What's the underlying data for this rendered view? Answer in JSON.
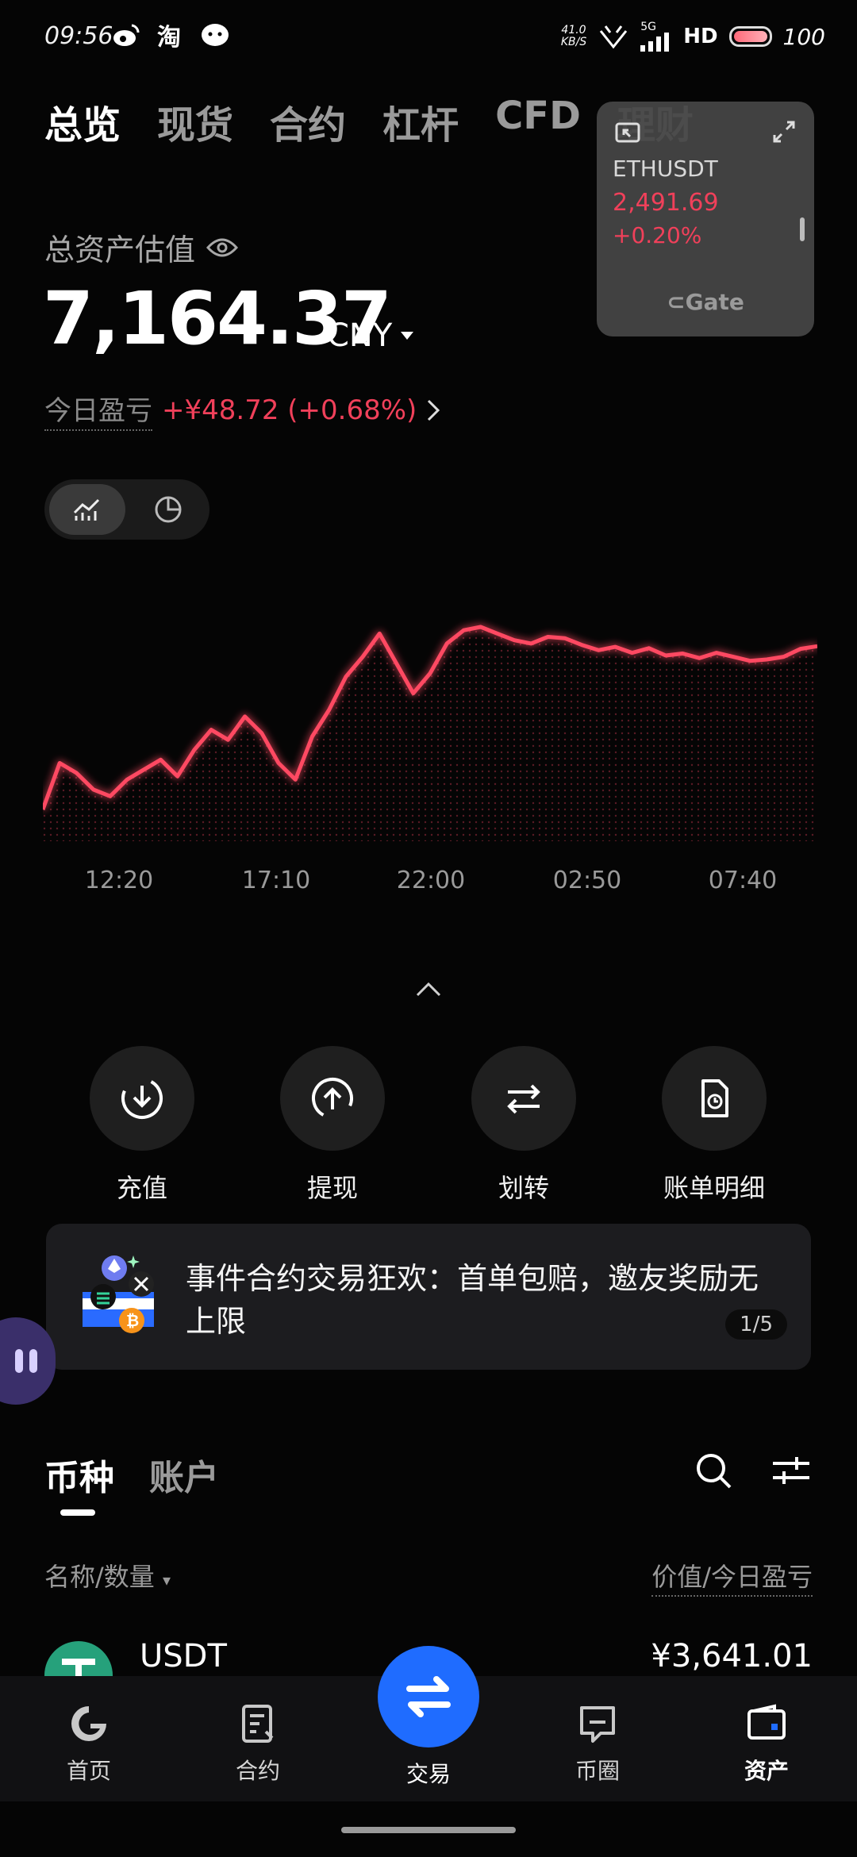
{
  "status_bar": {
    "time": "09:56",
    "net_speed_value": "41.0",
    "net_speed_unit": "KB/S",
    "network": "5G",
    "hd": "HD",
    "battery": "100"
  },
  "top_tabs": [
    {
      "label": "总览",
      "active": true
    },
    {
      "label": "现货",
      "active": false
    },
    {
      "label": "合约",
      "active": false
    },
    {
      "label": "杠杆",
      "active": false
    },
    {
      "label": "CFD",
      "active": false
    },
    {
      "label": "理财",
      "active": false
    }
  ],
  "float_widget": {
    "symbol": "ETHUSDT",
    "price": "2,491.69",
    "change": "+0.20%",
    "logo": "Gate"
  },
  "assets": {
    "label": "总资产估值",
    "value": "7,164.37",
    "currency": "CNY",
    "pnl_label": "今日盈亏",
    "pnl_value": "+¥48.72 (+0.68%)"
  },
  "chart_data": {
    "type": "line",
    "x": [
      "12:20",
      "17:10",
      "22:00",
      "02:50",
      "07:40"
    ],
    "series": [
      {
        "values": [
          6940,
          7010,
          6995,
          6970,
          6960,
          6985,
          7000,
          7015,
          6990,
          7030,
          7060,
          7045,
          7080,
          7055,
          7010,
          6985,
          7050,
          7090,
          7140,
          7170,
          7205,
          7160,
          7115,
          7145,
          7190,
          7210,
          7215,
          7205,
          7195,
          7190,
          7200,
          7198,
          7188,
          7180,
          7185,
          7176,
          7183,
          7172,
          7175,
          7168,
          7176,
          7170,
          7164,
          7166,
          7170,
          7182,
          7186
        ]
      }
    ],
    "grid": false,
    "legend": "none",
    "line_color": "#ff4a62"
  },
  "actions": [
    {
      "label": "充值",
      "icon": "deposit-icon"
    },
    {
      "label": "提现",
      "icon": "withdraw-icon"
    },
    {
      "label": "划转",
      "icon": "transfer-icon"
    },
    {
      "label": "账单明细",
      "icon": "bill-icon"
    }
  ],
  "banner": {
    "text": "事件合约交易狂欢：首单包赔，邀友奖励无上限",
    "pager": "1/5"
  },
  "section_tabs": [
    {
      "label": "币种",
      "active": true
    },
    {
      "label": "账户",
      "active": false
    }
  ],
  "list_header": {
    "left": "名称/数量",
    "right": "价值/今日盈亏"
  },
  "asset_rows": [
    {
      "name": "USDT",
      "value": "¥3,641.01"
    }
  ],
  "bottom_nav": [
    {
      "label": "首页",
      "icon": "home-icon"
    },
    {
      "label": "合约",
      "icon": "contract-icon"
    },
    {
      "label": "交易",
      "icon": "trade-icon"
    },
    {
      "label": "币圈",
      "icon": "community-icon"
    },
    {
      "label": "资产",
      "icon": "wallet-icon",
      "active": true
    }
  ],
  "colors": {
    "accent_red": "#f0405a",
    "trade_blue": "#1f6cff",
    "usdt_green": "#26a17b"
  }
}
